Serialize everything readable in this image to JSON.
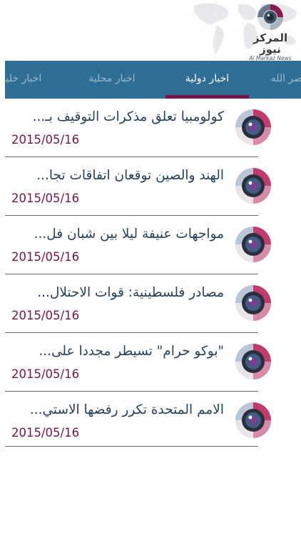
{
  "header": {
    "logo_ar": "المركز نيوز",
    "logo_en": "Al Markaz News"
  },
  "tabs": [
    {
      "label": "اخبار خليجية",
      "active": false
    },
    {
      "label": "اخبار محلية",
      "active": false
    },
    {
      "label": "اخبار دولية",
      "active": true
    },
    {
      "label": "نصر الله",
      "active": false
    }
  ],
  "news": [
    {
      "title": "كولومبيا تعلق مذكرات التوقيف بـ...",
      "date": "2015/05/16"
    },
    {
      "title": "الهند والصين توقعان اتفاقات تجا...",
      "date": "2015/05/16"
    },
    {
      "title": "مواجهات عنيفة ليلا بين شبان فل...",
      "date": "2015/05/16"
    },
    {
      "title": "مصادر فلسطينية: قوات الاحتلال...",
      "date": "2015/05/16"
    },
    {
      "title": "\"بوكو حرام\" تسيطر مجددا على...",
      "date": "2015/05/16"
    },
    {
      "title": "الامم المتحدة تكرر رفضها الاستي...",
      "date": "2015/05/16"
    }
  ],
  "colors": {
    "tab_bar": "#2f6f95",
    "tab_active_text": "#ffffff",
    "tab_inactive_text": "#9cb8cb",
    "accent": "#7a1348",
    "title_text": "#24415e"
  },
  "icons": {
    "thumbnail": "camera-lens-icon",
    "logo": "globe-logo-icon"
  }
}
